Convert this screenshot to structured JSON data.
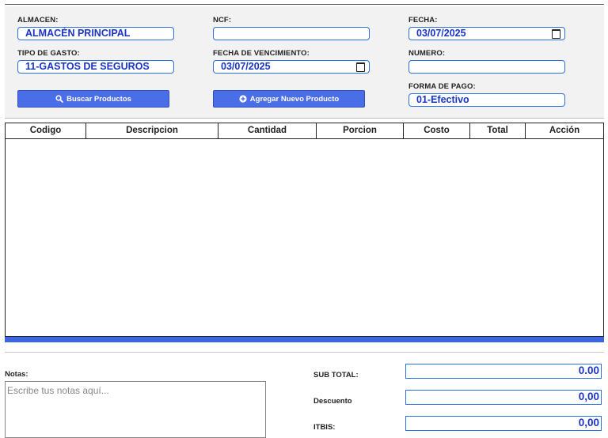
{
  "form": {
    "almacen": {
      "label": "ALMACEN:",
      "value": "ALMACÉN PRINCIPAL"
    },
    "ncf": {
      "label": "NCF:",
      "value": ""
    },
    "fecha": {
      "label": "FECHA:",
      "value": "03/07/2025"
    },
    "tipo_gasto": {
      "label": "TIPO DE GASTO:",
      "value": "11-GASTOS DE SEGUROS"
    },
    "fecha_vencimiento": {
      "label": "FECHA DE VENCIMIENTO:",
      "value": "03/07/2025"
    },
    "numero": {
      "label": "NUMERO:",
      "value": ""
    },
    "forma_pago": {
      "label": "FORMA DE PAGO:",
      "value": "01-Efectivo"
    },
    "buscar_button": "Buscar Productos",
    "agregar_button": "Agregar Nuevo Producto"
  },
  "table": {
    "headers": [
      "Codigo",
      "Descripcion",
      "Cantidad",
      "Porcion",
      "Costo",
      "Total",
      "Acción"
    ],
    "rows": []
  },
  "notes": {
    "label": "Notas:",
    "placeholder": "Escribe tus notas aquí..."
  },
  "totals": {
    "subtotal": {
      "label": "SUB TOTAL:",
      "value": "0.00"
    },
    "descuento": {
      "label": "Descuento",
      "value": "0,00"
    },
    "itbis": {
      "label": "ITBIS:",
      "value": "0,00"
    }
  },
  "colors": {
    "accent": "#2b6fe6",
    "value_text": "#1a34c8",
    "button_bg": "#4a6ee8",
    "bar": "#3c63e0"
  },
  "icons": {
    "buscar": "search-icon",
    "agregar": "plus-circle-icon",
    "date": "calendar-icon"
  }
}
